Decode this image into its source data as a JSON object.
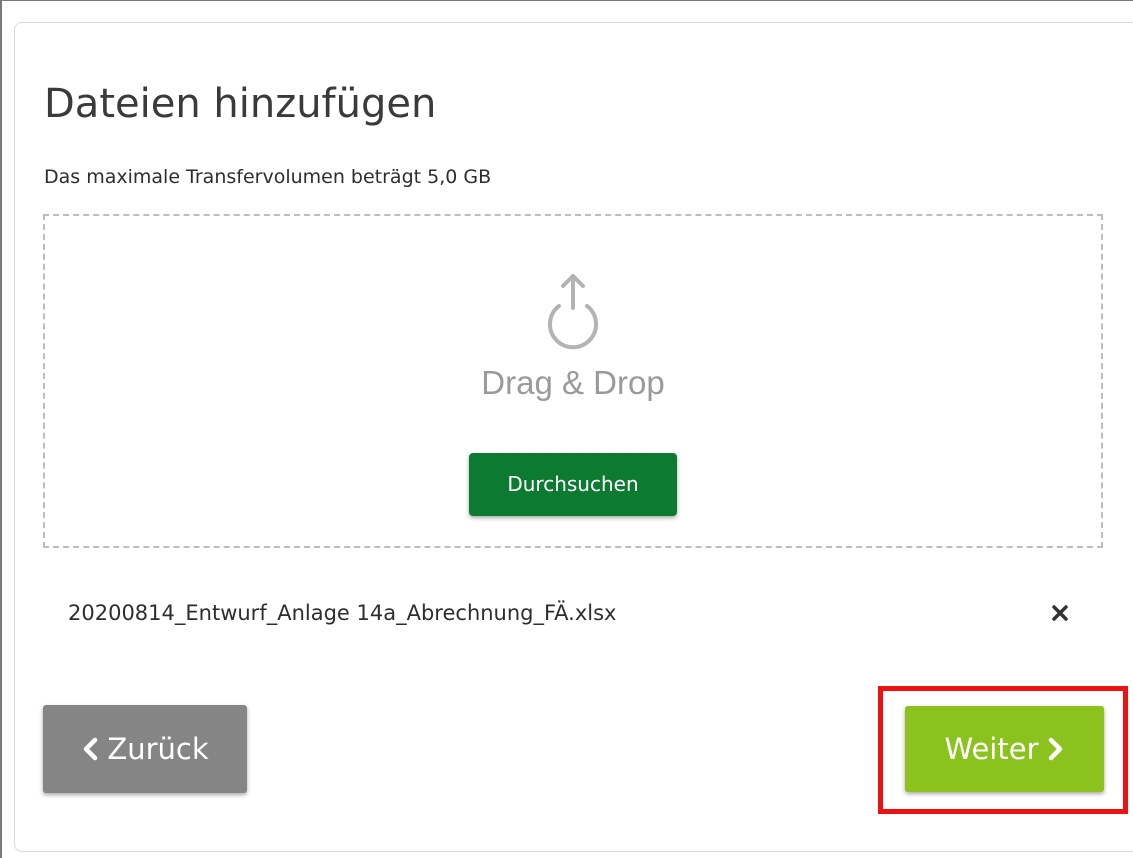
{
  "upload": {
    "title": "Dateien hinzufügen",
    "max_volume_text": "Das maximale Transfervolumen beträgt 5,0 GB",
    "dropzone": {
      "label": "Drag & Drop",
      "icon": "upload-icon",
      "browse_label": "Durchsuchen"
    },
    "files": [
      {
        "name": "20200814_Entwurf_Anlage 14a_Abrechnung_FÄ.xlsx",
        "remove_icon": "close-icon"
      }
    ]
  },
  "navigation": {
    "back_label": "Zurück",
    "back_icon": "chevron-left-icon",
    "next_label": "Weiter",
    "next_icon": "chevron-right-icon"
  },
  "colors": {
    "browse_button": "#0d7a32",
    "back_button": "#858585",
    "next_button": "#8bc21e",
    "highlight": "#ee1111"
  }
}
